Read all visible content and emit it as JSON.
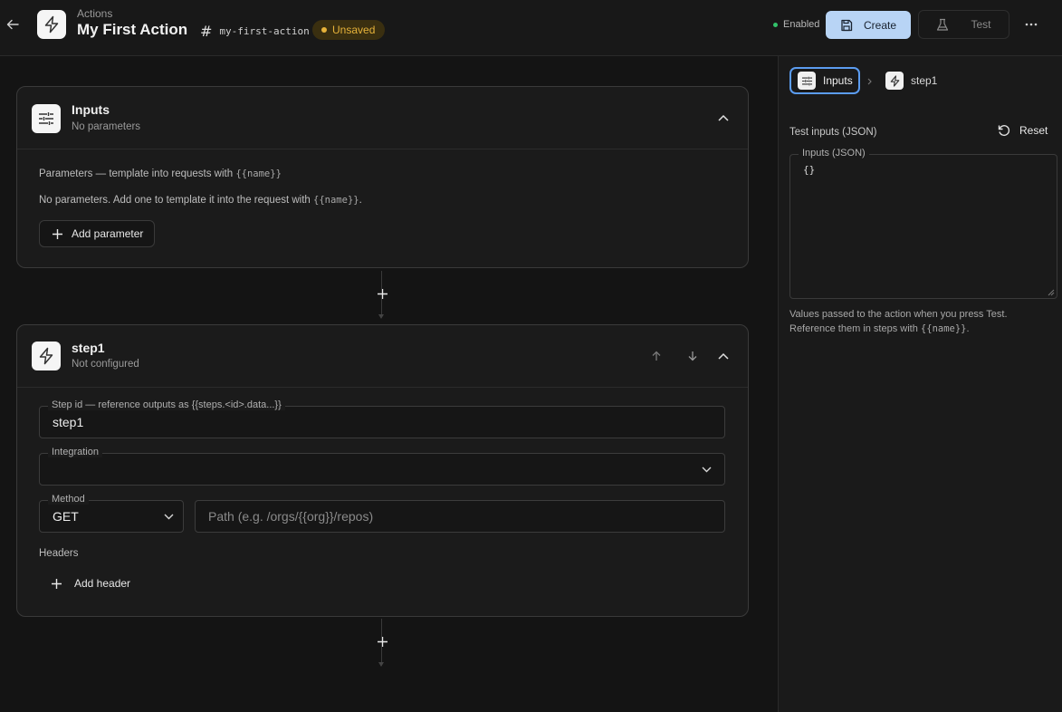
{
  "header": {
    "breadcrumb": "Actions",
    "title": "My First Action",
    "slug": "my-first-action",
    "status_badge": "Unsaved",
    "enabled_label": "Enabled",
    "create_label": "Create",
    "test_label": "Test"
  },
  "inputs_card": {
    "title": "Inputs",
    "subtitle": "No parameters",
    "params_label": "Parameters — template into requests with",
    "params_token": "{{name}}",
    "empty_text": "No parameters. Add one to template it into the request with",
    "empty_token": "{{name}}",
    "empty_suffix": ".",
    "add_param_label": "Add parameter"
  },
  "step_card": {
    "title": "step1",
    "subtitle": "Not configured",
    "step_id_legend": "Step id — reference outputs as {{steps.<id>.data...}}",
    "step_id_value": "step1",
    "integration_legend": "Integration",
    "integration_value": "",
    "method_legend": "Method",
    "method_value": "GET",
    "path_placeholder": "Path (e.g. /orgs/{{org}}/repos)",
    "headers_label": "Headers",
    "add_header_label": "Add header"
  },
  "side": {
    "tab_inputs": "Inputs",
    "tab_step": "step1",
    "test_inputs_label": "Test inputs (JSON)",
    "reset_label": "Reset",
    "json_legend": "Inputs (JSON)",
    "json_value": "{}",
    "help_line1": "Values passed to the action when you press Test.",
    "help_line2_prefix": "Reference them in steps with",
    "help_token": "{{name}}",
    "help_suffix": "."
  },
  "colors": {
    "accent": "#5b9cf0",
    "create_bg": "#b8d4f5",
    "unsaved": "#e6b23a",
    "enabled_dot": "#32c26a"
  },
  "icons": [
    "arrow-left-icon",
    "lightning-icon",
    "hash-icon",
    "save-icon",
    "flask-icon",
    "more-icon",
    "sliders-icon",
    "chevron-up-icon",
    "plus-icon",
    "arrow-up-icon",
    "arrow-down-icon",
    "chevron-down-icon",
    "chevron-right-icon",
    "reset-icon"
  ]
}
